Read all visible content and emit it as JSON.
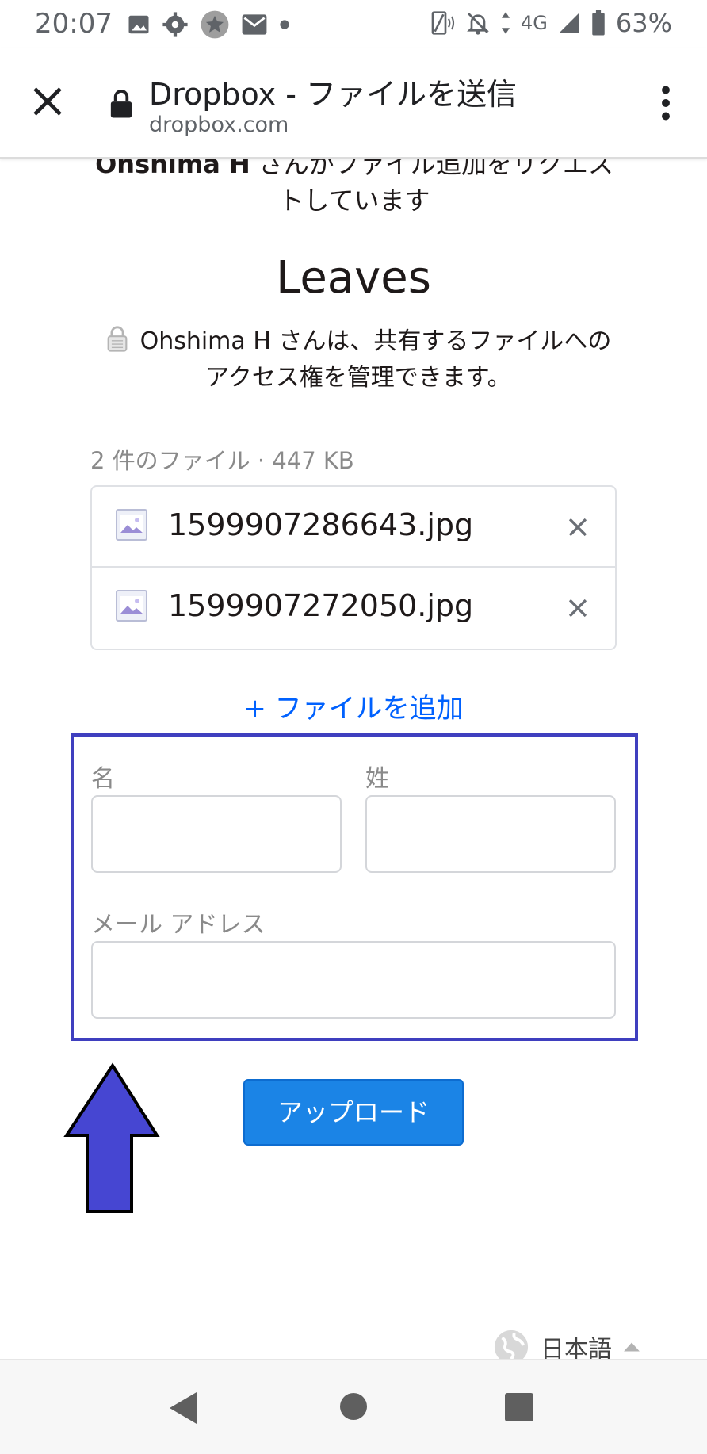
{
  "status_bar": {
    "time": "20:07",
    "network": "4G",
    "battery": "63%",
    "icons": [
      "image-icon",
      "settings-icon",
      "star-icon",
      "gmail-icon",
      "dot-icon",
      "nfc-icon",
      "mute-icon",
      "data-arrows-icon",
      "signal-icon",
      "battery-icon"
    ]
  },
  "browser": {
    "title": "Dropbox - ファイルを送信",
    "url": "dropbox.com",
    "close_icon": "close-icon",
    "lock_icon": "lock-icon",
    "menu_icon": "more-vert-icon"
  },
  "page": {
    "request_name": "Ohshima H",
    "request_text": " さんがファイル追加をリクエストしています",
    "folder_title": "Leaves",
    "access_note": "Ohshima H さんは、共有するファイルへのアクセス権を管理できます。",
    "files_count": "2 件のファイル · 447 KB",
    "files": [
      {
        "name": "1599907286643.jpg",
        "icon": "image-file-icon"
      },
      {
        "name": "1599907272050.jpg",
        "icon": "image-file-icon"
      }
    ],
    "add_files": "+ ファイルを追加",
    "form": {
      "first_name_label": "名",
      "first_name_value": "",
      "last_name_label": "姓",
      "last_name_value": "",
      "email_label": "メール アドレス",
      "email_value": ""
    },
    "upload_button": "アップロード",
    "language": "日本語"
  },
  "annotation": {
    "highlight_color": "#3f3fbf",
    "arrow_color": "#4646d2"
  },
  "colors": {
    "accent": "#0061fe",
    "button": "#1b84e6"
  }
}
